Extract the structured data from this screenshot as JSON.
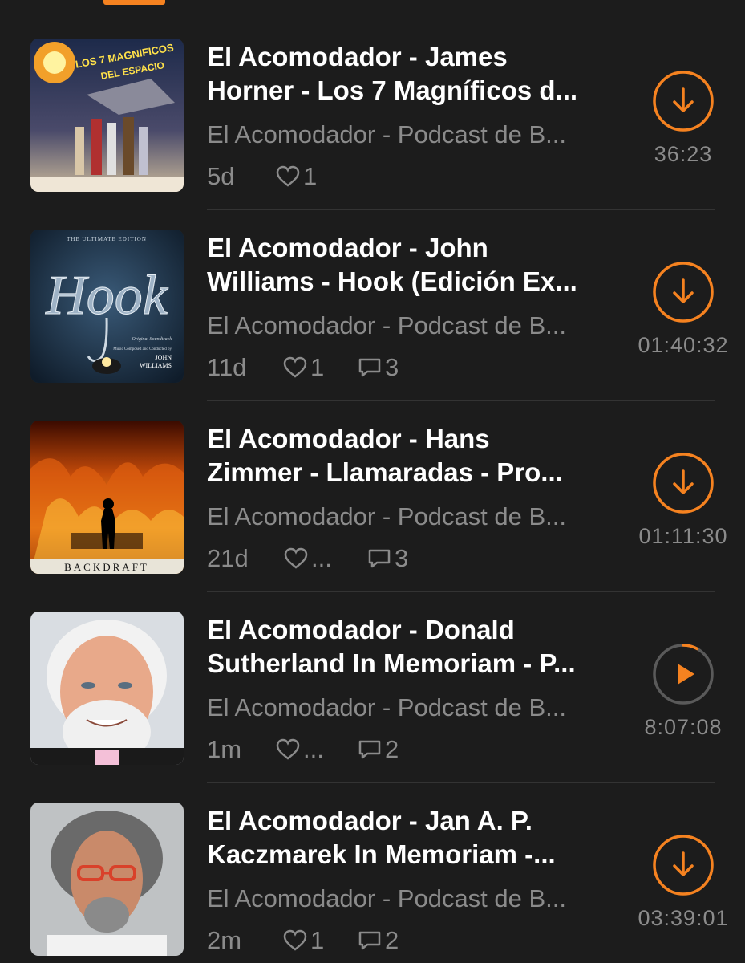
{
  "accent_color": "#f58220",
  "episodes": [
    {
      "title_line1": "El Acomodador - James",
      "title_line2": "Horner - Los 7 Magníficos d...",
      "podcast": "El Acomodador - Podcast de B...",
      "age": "5d",
      "likes": "1",
      "comments": "",
      "duration": "36:23",
      "action": "download-icon",
      "artwork": "los-7-magnificos-del-espacio-cover",
      "artwork_text": [
        "LOS 7 MAGNIFICOS",
        "DEL ESPACIO"
      ]
    },
    {
      "title_line1": "El Acomodador - John",
      "title_line2": "Williams - Hook (Edición Ex...",
      "podcast": "El Acomodador - Podcast de B...",
      "age": "11d",
      "likes": "1",
      "comments": "3",
      "duration": "01:40:32",
      "action": "download-icon",
      "artwork": "hook-cover",
      "artwork_text": [
        "THE ULTIMATE EDITION",
        "Hook",
        "Original Soundtrack",
        "Music Composed and Conducted by",
        "JOHN",
        "WILLIAMS"
      ]
    },
    {
      "title_line1": "El Acomodador - Hans",
      "title_line2": "Zimmer - Llamaradas - Pro...",
      "podcast": "El Acomodador - Podcast de B...",
      "age": "21d",
      "likes": "...",
      "comments": "3",
      "duration": "01:11:30",
      "action": "download-icon",
      "artwork": "backdraft-cover",
      "artwork_text": [
        "BACKDRAFT"
      ]
    },
    {
      "title_line1": "El Acomodador - Donald",
      "title_line2": "Sutherland In Memoriam - P...",
      "podcast": "El Acomodador - Podcast de B...",
      "age": "1m",
      "likes": "...",
      "comments": "2",
      "duration": "8:07:08",
      "action": "play-icon",
      "progress": 0.08,
      "artwork": "donald-sutherland-portrait",
      "artwork_text": []
    },
    {
      "title_line1": "El Acomodador - Jan A. P.",
      "title_line2": "Kaczmarek In Memoriam -...",
      "podcast": "El Acomodador - Podcast de B...",
      "age": "2m",
      "likes": "1",
      "comments": "2",
      "duration": "03:39:01",
      "action": "download-icon",
      "artwork": "jan-kaczmarek-portrait",
      "artwork_text": []
    }
  ]
}
